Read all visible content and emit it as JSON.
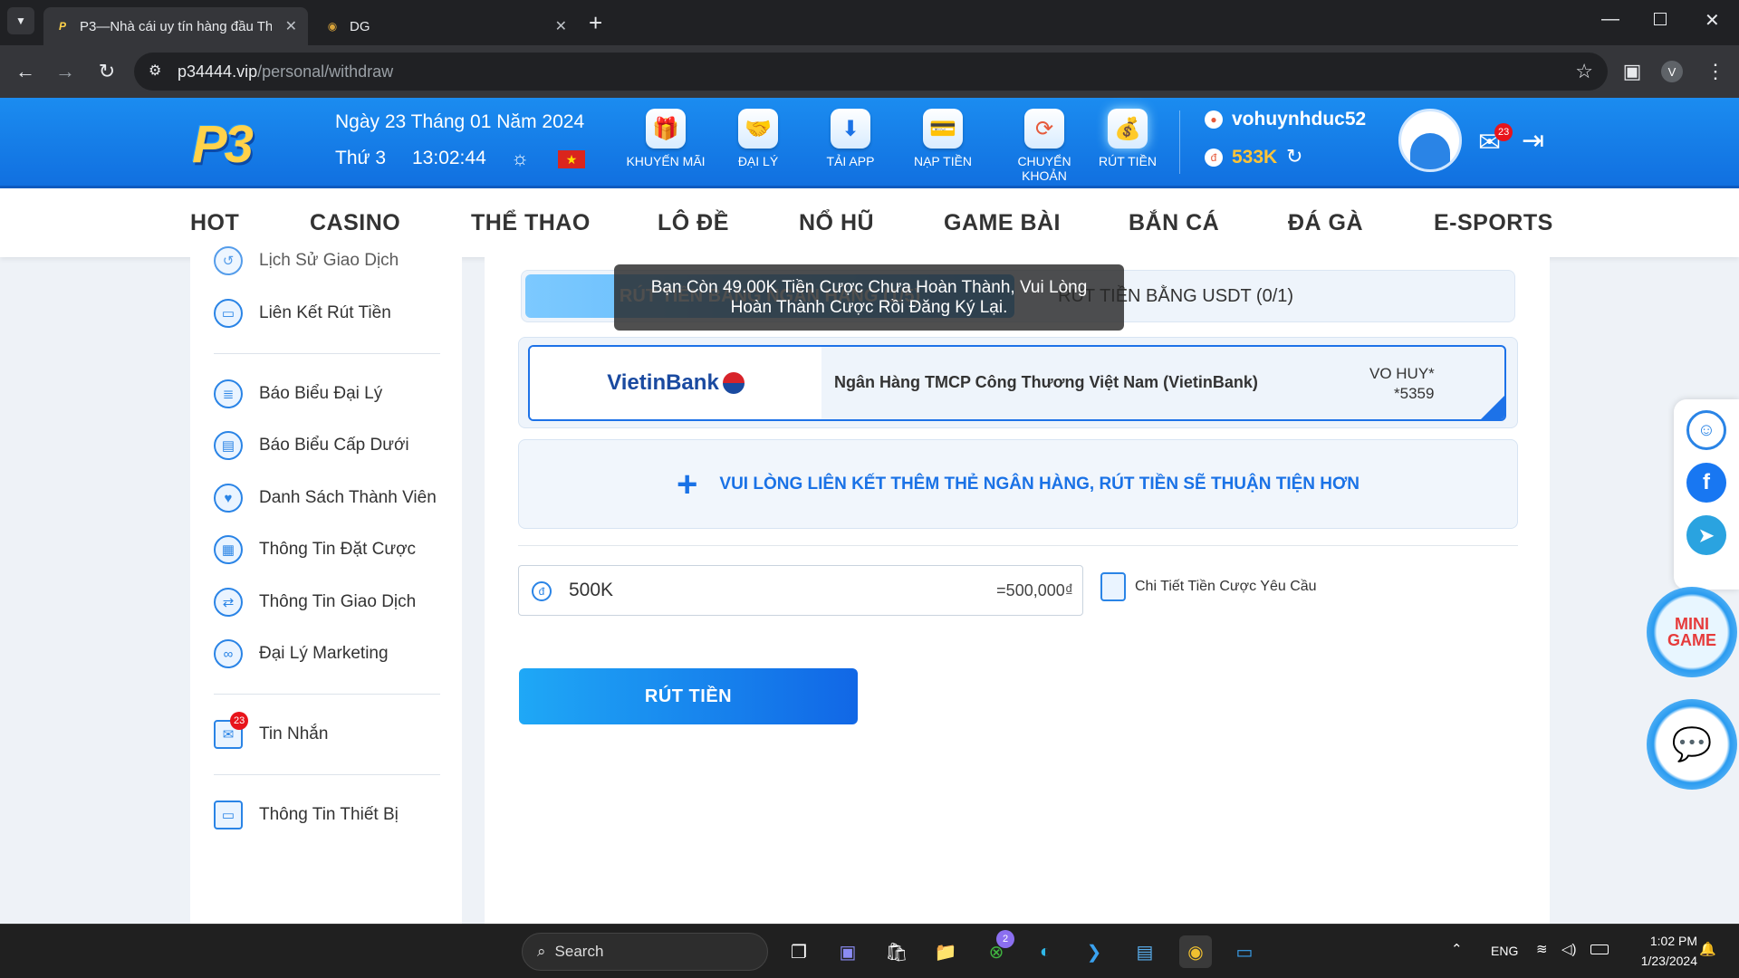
{
  "browser": {
    "tabs": [
      {
        "title": "P3—Nhà cái uy tín hàng đầu Th",
        "active": true
      },
      {
        "title": "DG",
        "active": false
      }
    ],
    "url_host": "p34444.vip",
    "url_path": "/personal/withdraw",
    "profile_initial": "V"
  },
  "header": {
    "logo_text": "P3",
    "date_line": "Ngày 23 Tháng 01 Năm 2024",
    "weekday": "Thứ 3",
    "time": "13:02:44",
    "actions": [
      {
        "label": "KHUYẾN MÃI",
        "icon": "gift-icon"
      },
      {
        "label": "ĐẠI LÝ",
        "icon": "handshake-icon"
      },
      {
        "label": "TẢI APP",
        "icon": "download-app-icon"
      },
      {
        "label": "NẠP TIỀN",
        "icon": "wallet-icon"
      },
      {
        "label": "CHUYỂN KHOẢN",
        "icon": "transfer-icon"
      },
      {
        "label": "RÚT TIỀN",
        "icon": "money-bag-icon"
      }
    ],
    "username": "vohuynhduc52",
    "balance": "533K",
    "mail_badge": "23"
  },
  "nav": [
    "HOT",
    "CASINO",
    "THỂ THAO",
    "LÔ ĐỀ",
    "NỔ HŨ",
    "GAME BÀI",
    "BẮN CÁ",
    "ĐÁ GÀ",
    "E-SPORTS"
  ],
  "sidebar": {
    "items": [
      {
        "label": "Lịch Sử Giao Dịch"
      },
      {
        "label": "Liên Kết Rút Tiền"
      },
      {
        "label": "Báo Biểu Đại Lý"
      },
      {
        "label": "Báo Biểu Cấp Dưới"
      },
      {
        "label": "Danh Sách Thành Viên"
      },
      {
        "label": "Thông Tin Đặt Cược"
      },
      {
        "label": "Thông Tin Giao Dịch"
      },
      {
        "label": "Đại Lý Marketing"
      },
      {
        "label": "Tin Nhắn"
      },
      {
        "label": "Thông Tin Thiết Bị"
      }
    ],
    "messages_badge": "23"
  },
  "withdraw": {
    "tab_bank": "RÚT TIỀN BẰNG NGÂN HÀNG (1/5)",
    "tab_usdt": "RÚT TIỀN BẰNG USDT (0/1)",
    "bank_logo": "VietinBank",
    "bank_name": "Ngân Hàng TMCP Công Thương Việt Nam (VietinBank)",
    "holder": "VO HUY*",
    "account": "*5359",
    "add_card": "VUI LÒNG LIÊN KẾT THÊM THẺ NGÂN HÀNG, RÚT TIỀN SẼ THUẬN TIỆN HƠN",
    "amount": "500K",
    "amount_equivalent": "=500,000₫",
    "detail_link": "Chi Tiết Tiền Cược Yêu Cầu",
    "submit": "RÚT TIỀN"
  },
  "toast": {
    "line1": "Bạn Còn 49.00K Tiền Cược Chưa Hoàn Thành, Vui Lòng",
    "line2": "Hoàn Thành Cược Rồi Đăng Ký Lại."
  },
  "floating": {
    "mini_game": "MINI GAME"
  },
  "taskbar": {
    "search": "Search",
    "lang": "ENG",
    "time": "1:02 PM",
    "date": "1/23/2024",
    "xbox_badge": "2"
  }
}
